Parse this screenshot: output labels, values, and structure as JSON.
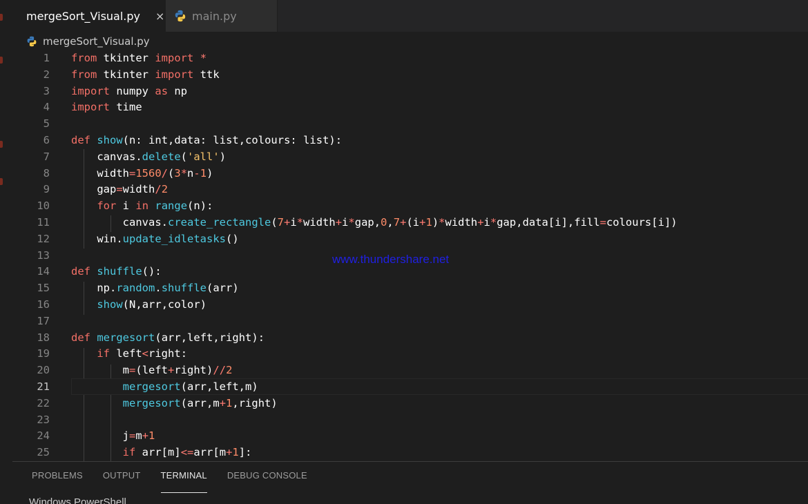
{
  "tabs": [
    {
      "label": "mergeSort_Visual.py",
      "active": true,
      "close": "×"
    },
    {
      "label": "main.py",
      "active": false
    }
  ],
  "breadcrumb": {
    "file": "mergeSort_Visual.py"
  },
  "watermark": "www.thundershare.net",
  "editor": {
    "current_line": 21,
    "lines": [
      {
        "n": "1"
      },
      {
        "n": "2"
      },
      {
        "n": "3"
      },
      {
        "n": "4"
      },
      {
        "n": "5"
      },
      {
        "n": "6"
      },
      {
        "n": "7"
      },
      {
        "n": "8"
      },
      {
        "n": "9"
      },
      {
        "n": "10"
      },
      {
        "n": "11"
      },
      {
        "n": "12"
      },
      {
        "n": "13"
      },
      {
        "n": "14"
      },
      {
        "n": "15"
      },
      {
        "n": "16"
      },
      {
        "n": "17"
      },
      {
        "n": "18"
      },
      {
        "n": "19"
      },
      {
        "n": "20"
      },
      {
        "n": "21"
      },
      {
        "n": "22"
      },
      {
        "n": "23"
      },
      {
        "n": "24"
      },
      {
        "n": "25"
      }
    ],
    "code": [
      "from tkinter import *",
      "from tkinter import ttk",
      "import numpy as np",
      "import time",
      "",
      "def show(n: int,data: list,colours: list):",
      "    canvas.delete('all')",
      "    width=1560/(3*n-1)",
      "    gap=width/2",
      "    for i in range(n):",
      "        canvas.create_rectangle(7+i*width+i*gap,0,7+(i+1)*width+i*gap,data[i],fill=colours[i])",
      "    win.update_idletasks()",
      "",
      "def shuffle():",
      "    np.random.shuffle(arr)",
      "    show(N,arr,color)",
      "",
      "def mergesort(arr,left,right):",
      "    if left<right:",
      "        m=(left+right)//2",
      "        mergesort(arr,left,m)",
      "        mergesort(arr,m+1,right)",
      "",
      "        j=m+1",
      "        if arr[m]<=arr[m+1]:"
    ]
  },
  "panel": {
    "tabs": [
      "PROBLEMS",
      "OUTPUT",
      "TERMINAL",
      "DEBUG CONSOLE"
    ],
    "active_tab": "TERMINAL",
    "terminal_text": "Windows PowerShell"
  },
  "colors": {
    "background": "#1e1e1e",
    "keyword": "#f47067",
    "function": "#4ec9e0",
    "number": "#ff8c69",
    "string": "#f5c26b",
    "watermark": "#2020e0"
  }
}
